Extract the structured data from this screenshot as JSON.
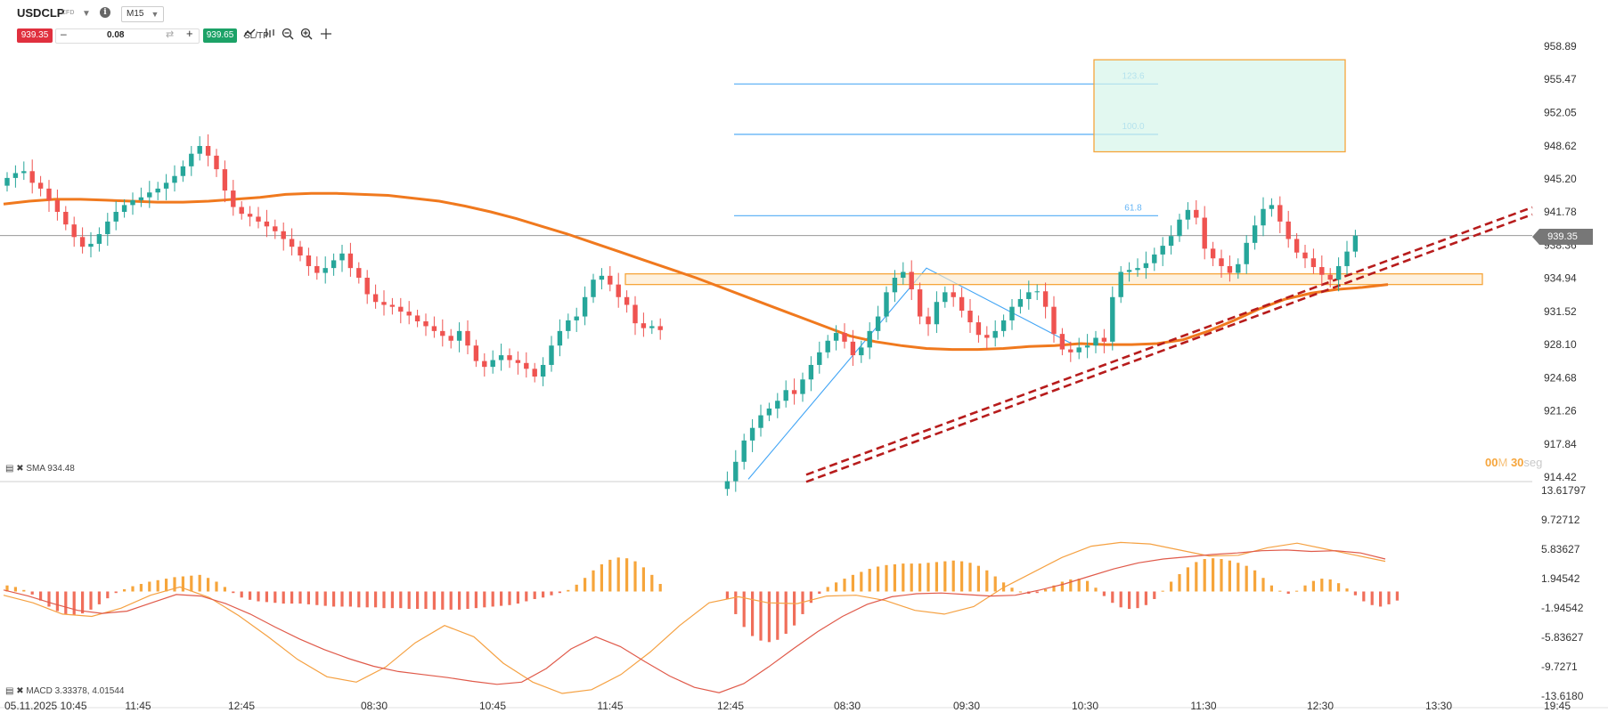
{
  "header": {
    "symbol": "USDCLP",
    "instrument_type": "CFD",
    "timeframe": "M15",
    "sell_price": "939.35",
    "buy_price": "939.65",
    "quantity": "0.08",
    "sltp_label": "SL/TP",
    "minus": "–",
    "plus": "+",
    "info": "i"
  },
  "indicators": {
    "sma_label": "SMA 934.48",
    "macd_label": "MACD 3.33378, 4.01544"
  },
  "timer": {
    "minutes": "00",
    "m": "M",
    "seconds": "30",
    "seg": "seg"
  },
  "colors": {
    "bull": "#26a69a",
    "bear": "#ef5350",
    "sma": "#f0791e",
    "trend": "#b71c1c",
    "fib": "#64b5f6",
    "zone": "#f6a53b",
    "macd_pos": "#f6a53b",
    "macd_neg": "#f06e5a"
  },
  "chart_data": [
    {
      "type": "candlestick",
      "title": "USDCLP M15",
      "y_ticks": [
        "958.89",
        "955.47",
        "952.05",
        "948.62",
        "945.20",
        "941.78",
        "938.36",
        "934.94",
        "931.52",
        "928.10",
        "924.68",
        "921.26",
        "917.84",
        "914.42"
      ],
      "ylim": [
        914.42,
        958.89
      ],
      "current_price": "939.35",
      "x_ticks": [
        "05.11.2025 10:45",
        "11:45",
        "12:45",
        "08:30",
        "10:45",
        "11:45",
        "12:45",
        "08:30",
        "09:30",
        "10:30",
        "11:30",
        "12:30",
        "13:30",
        "19:45"
      ],
      "fibonacci_levels": [
        "123.6",
        "100.0",
        "61.8"
      ],
      "fibonacci_values": [
        955.0,
        949.8,
        941.4
      ],
      "resistance_zone": [
        934.3,
        935.4
      ],
      "target_zone": [
        948.0,
        957.5
      ],
      "sma_period_value": 934.48,
      "close_series": [
        945.3,
        945.8,
        946.0,
        944.8,
        944.2,
        943.0,
        941.8,
        940.5,
        939.2,
        938.2,
        938.5,
        939.5,
        940.8,
        941.8,
        942.5,
        943.0,
        943.3,
        943.8,
        944.2,
        944.8,
        945.5,
        946.5,
        947.8,
        948.6,
        947.6,
        946.2,
        944.0,
        942.3,
        941.6,
        941.3,
        940.8,
        940.3,
        939.8,
        939.0,
        938.2,
        937.3,
        936.2,
        935.5,
        936.0,
        936.8,
        937.5,
        936.0,
        935.0,
        933.3,
        932.5,
        932.2,
        932.0,
        931.5,
        931.1,
        930.5,
        930.0,
        929.5,
        929.0,
        928.5,
        929.5,
        928.0,
        926.4,
        925.8,
        926.5,
        927.0,
        926.5,
        926.2,
        925.6,
        924.8,
        926.0,
        928.0,
        929.5,
        930.6,
        931.0,
        933.0,
        934.8,
        935.2,
        934.3,
        933.0,
        932.2,
        930.3,
        929.8,
        930.0,
        929.6,
        null,
        null,
        null,
        null,
        null,
        null,
        null,
        914.0,
        916.0,
        918.2,
        919.5,
        920.8,
        921.5,
        922.3,
        923.4,
        923.0,
        924.5,
        926.0,
        927.3,
        928.5,
        929.3,
        928.4,
        927.0,
        927.8,
        929.5,
        931.0,
        933.5,
        935.0,
        935.6,
        933.8,
        931.0,
        930.2,
        932.5,
        933.5,
        933.0,
        931.6,
        930.4,
        929.1,
        928.8,
        929.5,
        930.6,
        932.0,
        932.8,
        933.5,
        933.6,
        932.0,
        929.2,
        927.6,
        927.3,
        927.8,
        928.0,
        928.8,
        928.4,
        933.0,
        935.6,
        935.8,
        936.0,
        936.5,
        937.4,
        938.3,
        939.3,
        941.0,
        942.0,
        941.2,
        938.0,
        937.0,
        936.2,
        935.5,
        936.4,
        938.6,
        940.4,
        942.1,
        942.5,
        940.8,
        939.0,
        937.6,
        937.0,
        936.1,
        935.3,
        934.8,
        936.2,
        937.7,
        939.35
      ],
      "sma_series": [
        942.6,
        942.9,
        943.1,
        943.1,
        943.0,
        942.9,
        942.8,
        942.8,
        942.9,
        943.1,
        943.3,
        943.6,
        943.7,
        943.7,
        943.6,
        943.5,
        943.2,
        942.9,
        942.4,
        941.8,
        941.1,
        940.3,
        939.5,
        938.6,
        937.7,
        936.8,
        935.9,
        935.0,
        934.0,
        933.0,
        932.0,
        931.0,
        930.0,
        929.0,
        928.4,
        928.0,
        927.7,
        927.6,
        927.6,
        927.7,
        927.9,
        928.0,
        928.2,
        928.1,
        928.1,
        928.2,
        928.6,
        929.5,
        930.6,
        931.8,
        932.8,
        933.4,
        933.8,
        934.0,
        934.3
      ],
      "trendline": {
        "from": [
          914.3,
          "12:45"
        ],
        "to": [
          941.9,
          "19:45"
        ]
      }
    },
    {
      "type": "bar",
      "title": "MACD",
      "y_ticks": [
        "13.61797",
        "9.72712",
        "5.83627",
        "1.94542",
        "-1.94542",
        "-5.83627",
        "-9.7271",
        "-13.6180"
      ],
      "ylim": [
        -13.618,
        13.618
      ],
      "histogram": [
        0.8,
        0.6,
        0.2,
        -0.4,
        -1.2,
        -2.0,
        -2.6,
        -3.0,
        -3.1,
        -2.9,
        -2.4,
        -1.7,
        -0.9,
        -0.2,
        0.3,
        0.7,
        1.0,
        1.3,
        1.5,
        1.7,
        1.9,
        2.0,
        2.1,
        2.2,
        1.8,
        1.3,
        0.6,
        -0.2,
        -0.8,
        -1.1,
        -1.3,
        -1.4,
        -1.5,
        -1.6,
        -1.6,
        -1.6,
        -1.7,
        -1.8,
        -1.9,
        -2.0,
        -2.0,
        -2.0,
        -2.1,
        -2.1,
        -2.1,
        -2.2,
        -2.2,
        -2.2,
        -2.3,
        -2.3,
        -2.3,
        -2.4,
        -2.4,
        -2.4,
        -2.4,
        -2.3,
        -2.2,
        -2.1,
        -2.0,
        -1.9,
        -1.8,
        -1.6,
        -1.3,
        -1.0,
        -0.8,
        -0.5,
        -0.2,
        0.2,
        0.9,
        1.8,
        2.8,
        3.6,
        4.2,
        4.5,
        4.4,
        4.0,
        3.2,
        2.2,
        1.0,
        null,
        null,
        null,
        null,
        null,
        null,
        null,
        -1.0,
        -3.0,
        -4.7,
        -5.9,
        -6.5,
        -6.7,
        -6.4,
        -5.6,
        -4.5,
        -3.0,
        -1.5,
        -0.3,
        0.6,
        1.2,
        1.7,
        2.2,
        2.6,
        3.0,
        3.3,
        3.5,
        3.6,
        3.7,
        3.7,
        3.7,
        3.8,
        3.9,
        4.0,
        4.1,
        4.0,
        3.8,
        3.4,
        2.8,
        2.0,
        1.2,
        0.5,
        0.0,
        -0.3,
        -0.2,
        0.3,
        0.8,
        1.3,
        1.6,
        1.7,
        1.4,
        0.5,
        -0.6,
        -1.5,
        -2.1,
        -2.3,
        -2.2,
        -1.8,
        -1.0,
        0.1,
        1.3,
        2.3,
        3.2,
        3.9,
        4.3,
        4.4,
        4.3,
        4.1,
        3.8,
        3.4,
        2.8,
        1.8,
        0.8,
        0.1,
        -0.3,
        0.1,
        0.8,
        1.4,
        1.7,
        1.6,
        1.1,
        0.4,
        -0.5,
        -1.3,
        -1.8,
        -2.0,
        -1.7,
        -1.2
      ],
      "macd_series": [
        -0.5,
        -1.5,
        -3.0,
        -3.3,
        -2.2,
        -0.5,
        0.6,
        -0.8,
        -3.2,
        -6.0,
        -9.0,
        -11.3,
        -12.0,
        -10.0,
        -6.8,
        -4.5,
        -6.0,
        -9.5,
        -12.0,
        -13.5,
        -13.0,
        -11.0,
        -8.0,
        -4.5,
        -1.5,
        -0.7,
        -1.5,
        -1.6,
        -0.6,
        -0.5,
        -1.2,
        -2.5,
        -3.0,
        -2.0,
        0.5,
        2.5,
        4.5,
        6.0,
        6.5,
        6.3,
        5.5,
        4.7,
        4.8,
        5.8,
        6.4,
        5.6,
        4.8,
        4.0
      ],
      "signal_series": [
        0.2,
        -0.6,
        -1.6,
        -2.5,
        -2.9,
        -2.6,
        -1.5,
        -0.4,
        -0.6,
        -1.6,
        -3.0,
        -4.7,
        -6.3,
        -7.7,
        -8.9,
        -9.9,
        -10.6,
        -11.0,
        -11.4,
        -11.9,
        -12.3,
        -12.0,
        -10.2,
        -7.6,
        -6.0,
        -7.3,
        -9.3,
        -11.2,
        -12.7,
        -13.4,
        -12.2,
        -10.0,
        -7.6,
        -5.3,
        -3.3,
        -1.7,
        -0.7,
        -0.3,
        -0.2,
        -0.4,
        -0.6,
        -0.5,
        0.2,
        1.0,
        2.0,
        3.0,
        3.8,
        4.3,
        4.6,
        4.9,
        5.1,
        5.4,
        5.5,
        5.3,
        5.4,
        5.1,
        4.3
      ]
    }
  ]
}
